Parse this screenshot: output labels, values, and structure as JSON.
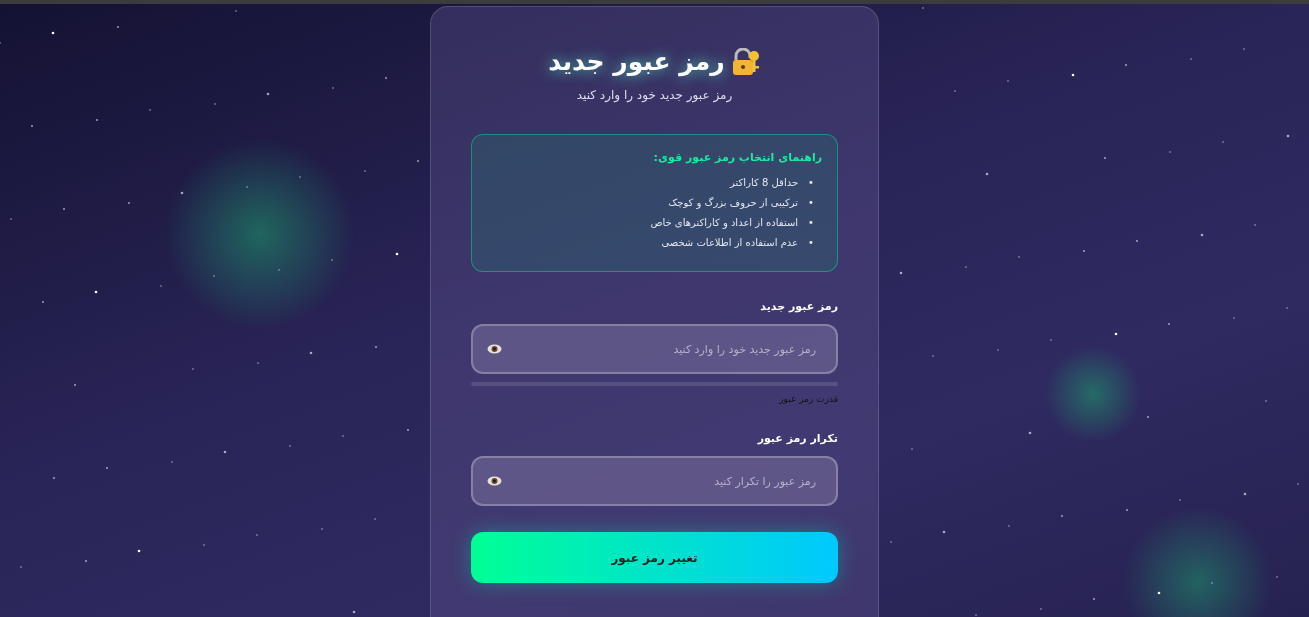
{
  "header": {
    "title": "رمز عبور جدید",
    "subtitle": "رمز عبور جدید خود را وارد کنید"
  },
  "tips": {
    "title": "راهنمای انتخاب رمز عبور قوی:",
    "items": [
      {
        "bullet": "•",
        "text": "حداقل 8 کاراکتر"
      },
      {
        "bullet": "•",
        "text": "ترکیبی از حروف بزرگ و کوچک"
      },
      {
        "bullet": "•",
        "text": "استفاده از اعداد و کاراکترهای خاص"
      },
      {
        "bullet": "•",
        "text": "عدم استفاده از اطلاعات شخصی"
      }
    ]
  },
  "fields": [
    {
      "label": "رمز عبور جدید",
      "placeholder": "رمز عبور جدید خود را وارد کنید",
      "strength": {
        "level": 0,
        "label": "قدرت رمز عبور"
      }
    },
    {
      "label": "تکرار رمز عبور",
      "placeholder": "رمز عبور را تکرار کنید"
    }
  ],
  "submit": {
    "label": "تغییر رمز عبور"
  }
}
